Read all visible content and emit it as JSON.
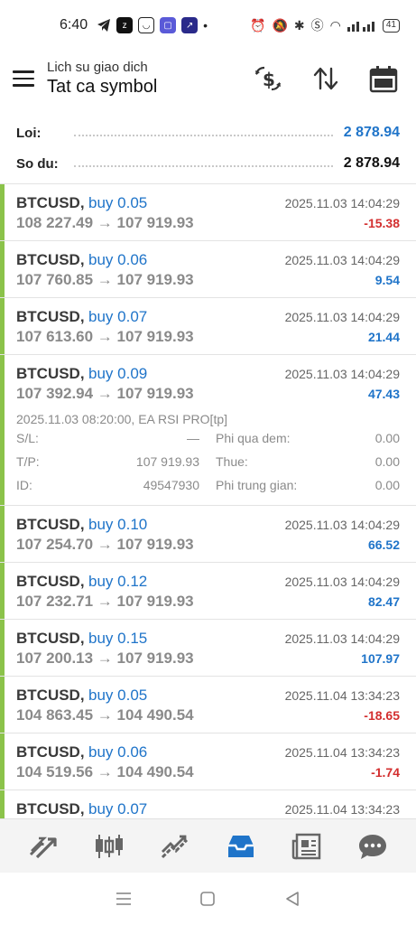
{
  "status_bar": {
    "time": "6:40",
    "battery": "41"
  },
  "header": {
    "subtitle": "Lich su giao dich",
    "title": "Tat ca symbol"
  },
  "summary": {
    "profit_label": "Loi:",
    "profit_value": "2 878.94",
    "balance_label": "So du:",
    "balance_value": "2 878.94"
  },
  "trades": [
    {
      "symbol": "BTCUSD,",
      "side": "buy 0.05",
      "time": "2025.11.03 14:04:29",
      "prices": "108 227.49 → 107 919.93",
      "profit": "-15.38",
      "sign": "neg"
    },
    {
      "symbol": "BTCUSD,",
      "side": "buy 0.06",
      "time": "2025.11.03 14:04:29",
      "prices": "107 760.85 → 107 919.93",
      "profit": "9.54",
      "sign": "pos"
    },
    {
      "symbol": "BTCUSD,",
      "side": "buy 0.07",
      "time": "2025.11.03 14:04:29",
      "prices": "107 613.60 → 107 919.93",
      "profit": "21.44",
      "sign": "pos"
    },
    {
      "symbol": "BTCUSD,",
      "side": "buy 0.09",
      "time": "2025.11.03 14:04:29",
      "prices": "107 392.94 → 107 919.93",
      "profit": "47.43",
      "sign": "pos"
    },
    {
      "symbol": "BTCUSD,",
      "side": "buy 0.10",
      "time": "2025.11.03 14:04:29",
      "prices": "107 254.70 → 107 919.93",
      "profit": "66.52",
      "sign": "pos"
    },
    {
      "symbol": "BTCUSD,",
      "side": "buy 0.12",
      "time": "2025.11.03 14:04:29",
      "prices": "107 232.71 → 107 919.93",
      "profit": "82.47",
      "sign": "pos"
    },
    {
      "symbol": "BTCUSD,",
      "side": "buy 0.15",
      "time": "2025.11.03 14:04:29",
      "prices": "107 200.13 → 107 919.93",
      "profit": "107.97",
      "sign": "pos"
    },
    {
      "symbol": "BTCUSD,",
      "side": "buy 0.05",
      "time": "2025.11.04 13:34:23",
      "prices": "104 863.45 → 104 490.54",
      "profit": "-18.65",
      "sign": "neg"
    },
    {
      "symbol": "BTCUSD,",
      "side": "buy 0.06",
      "time": "2025.11.04 13:34:23",
      "prices": "104 519.56 → 104 490.54",
      "profit": "-1.74",
      "sign": "neg"
    },
    {
      "symbol": "BTCUSD,",
      "side": "buy 0.07",
      "time": "2025.11.04 13:34:23",
      "prices": "",
      "profit": "",
      "sign": "pos"
    }
  ],
  "expanded_details": {
    "open_info": "2025.11.03 08:20:00, EA RSI PRO[tp]",
    "sl_label": "S/L:",
    "sl_value": "—",
    "tp_label": "T/P:",
    "tp_value": "107 919.93",
    "id_label": "ID:",
    "id_value": "49547930",
    "swap_label": "Phi qua dem:",
    "swap_value": "0.00",
    "tax_label": "Thue:",
    "tax_value": "0.00",
    "commission_label": "Phi trung gian:",
    "commission_value": "0.00"
  },
  "colors": {
    "accent": "#1f74c9",
    "negative": "#d32f2f",
    "buy_bar": "#8bc34a"
  },
  "icons": {
    "header": [
      "dollar-exchange-icon",
      "sort-icon",
      "calendar-icon"
    ],
    "bottom_nav": [
      "quotes-icon",
      "chart-icon",
      "trade-icon",
      "history-icon",
      "news-icon",
      "chat-icon"
    ]
  }
}
